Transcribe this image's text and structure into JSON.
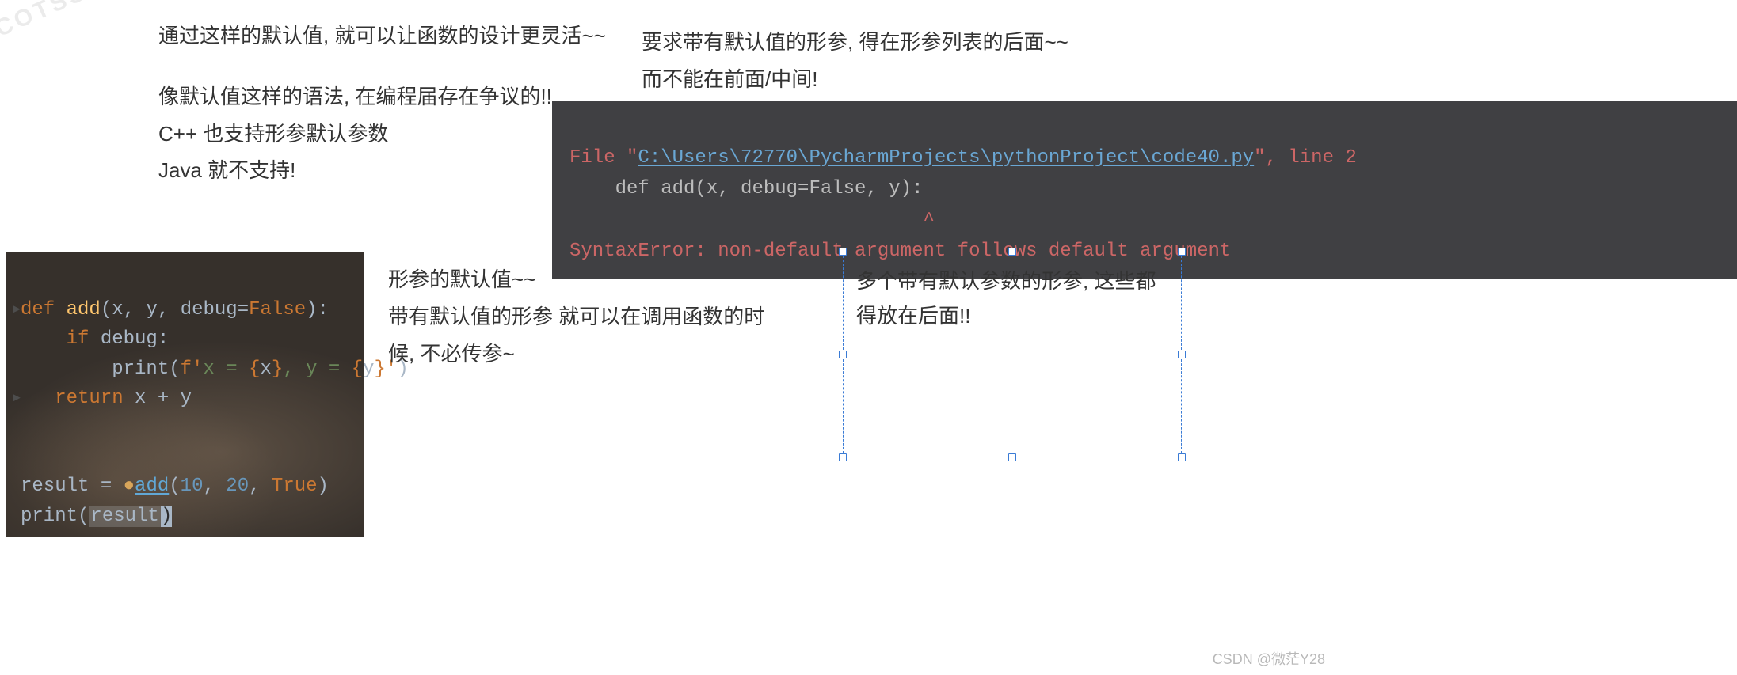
{
  "watermark": "COTSSI",
  "top_left": {
    "p1": "通过这样的默认值, 就可以让函数的设计更灵活~~",
    "p2": "像默认值这样的语法, 在编程届存在争议的!!",
    "p3": "C++ 也支持形参默认参数",
    "p4": "Java 就不支持!"
  },
  "top_right": {
    "p1": "要求带有默认值的形参, 得在形参列表的后面~~",
    "p2": "而不能在前面/中间!"
  },
  "error": {
    "file_label": "File ",
    "quote_open": "\"",
    "path": "C:\\Users\\72770\\PycharmProjects\\pythonProject\\code40.py",
    "quote_close": "\"",
    "line_suffix": ", line 2",
    "code_line": "    def add(x, debug=False, y):",
    "caret_line": "                               ^",
    "message": "SyntaxError: non-default argument follows default argument"
  },
  "code": {
    "l1_def": "def",
    "l1_name": "add",
    "l1_open": "(",
    "l1_p1": "x",
    "l1_c1": ", ",
    "l1_p2": "y",
    "l1_c2": ", ",
    "l1_p3": "debug",
    "l1_eq": "=",
    "l1_false": "False",
    "l1_close": "):",
    "l2_if": "if",
    "l2_cond": " debug:",
    "l3_print": "print",
    "l3_open": "(",
    "l3_fpre": "f'",
    "l3_s1": "x = ",
    "l3_b1o": "{",
    "l3_v1": "x",
    "l3_b1c": "}",
    "l3_s2": ", y = ",
    "l3_b2o": "{",
    "l3_v2": "y",
    "l3_b2c": "}",
    "l3_end": "'",
    "l3_close": ")",
    "l4_ret": "return",
    "l4_expr": " x + y",
    "l6_lhs": "result",
    "l6_eq": " = ",
    "l6_fn": "add",
    "l6_open": "(",
    "l6_a1": "10",
    "l6_c1": ", ",
    "l6_a2": "20",
    "l6_c2": ", ",
    "l6_a3": "True",
    "l6_close": ")",
    "l7_print": "print",
    "l7_open": "(",
    "l7_arg": "result",
    "l7_close": ")"
  },
  "mid_note": {
    "p1": "形参的默认值~~",
    "p2": "带有默认值的形参 就可以在调用函数的时候, 不必传参~"
  },
  "box": {
    "text": "多个带有默认参数的形参, 这些都得放在后面!!"
  },
  "credit": "CSDN @微茫Y28"
}
